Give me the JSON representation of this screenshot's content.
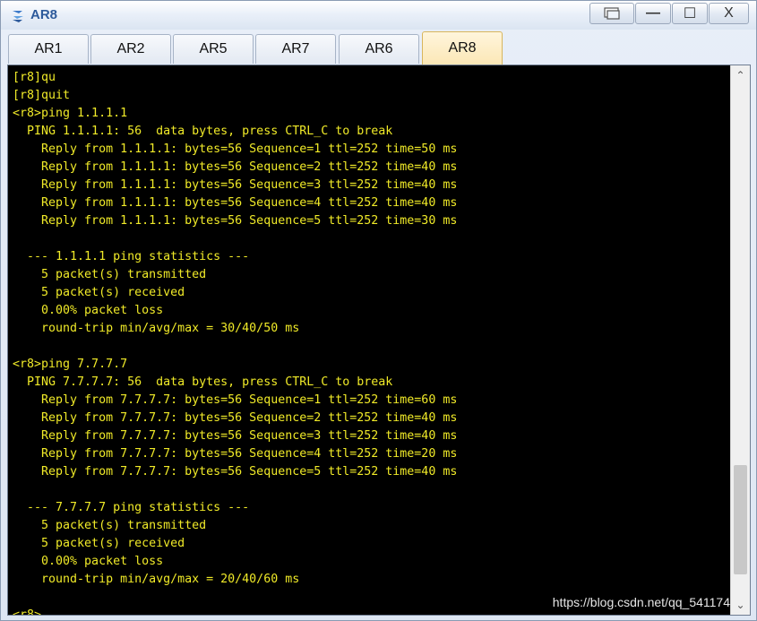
{
  "window": {
    "title": "AR8",
    "buttons": {
      "restore_label": "",
      "minimize_label": "—",
      "maximize_label": "☐",
      "close_label": "X"
    }
  },
  "tabs": [
    {
      "label": "AR1",
      "active": false
    },
    {
      "label": "AR2",
      "active": false
    },
    {
      "label": "AR5",
      "active": false
    },
    {
      "label": "AR7",
      "active": false
    },
    {
      "label": "AR6",
      "active": false
    },
    {
      "label": "AR8",
      "active": true
    }
  ],
  "terminal": {
    "text_color": "#f0ea28",
    "background": "#000000",
    "lines": [
      "[r8]qu",
      "[r8]quit",
      "<r8>ping 1.1.1.1",
      "  PING 1.1.1.1: 56  data bytes, press CTRL_C to break",
      "    Reply from 1.1.1.1: bytes=56 Sequence=1 ttl=252 time=50 ms",
      "    Reply from 1.1.1.1: bytes=56 Sequence=2 ttl=252 time=40 ms",
      "    Reply from 1.1.1.1: bytes=56 Sequence=3 ttl=252 time=40 ms",
      "    Reply from 1.1.1.1: bytes=56 Sequence=4 ttl=252 time=40 ms",
      "    Reply from 1.1.1.1: bytes=56 Sequence=5 ttl=252 time=30 ms",
      "",
      "  --- 1.1.1.1 ping statistics ---",
      "    5 packet(s) transmitted",
      "    5 packet(s) received",
      "    0.00% packet loss",
      "    round-trip min/avg/max = 30/40/50 ms",
      "",
      "<r8>ping 7.7.7.7",
      "  PING 7.7.7.7: 56  data bytes, press CTRL_C to break",
      "    Reply from 7.7.7.7: bytes=56 Sequence=1 ttl=252 time=60 ms",
      "    Reply from 7.7.7.7: bytes=56 Sequence=2 ttl=252 time=40 ms",
      "    Reply from 7.7.7.7: bytes=56 Sequence=3 ttl=252 time=40 ms",
      "    Reply from 7.7.7.7: bytes=56 Sequence=4 ttl=252 time=20 ms",
      "    Reply from 7.7.7.7: bytes=56 Sequence=5 ttl=252 time=40 ms",
      "",
      "  --- 7.7.7.7 ping statistics ---",
      "    5 packet(s) transmitted",
      "    5 packet(s) received",
      "    0.00% packet loss",
      "    round-trip min/avg/max = 20/40/60 ms",
      "",
      "<r8>"
    ]
  },
  "watermark": "https://blog.csdn.net/qq_541174"
}
